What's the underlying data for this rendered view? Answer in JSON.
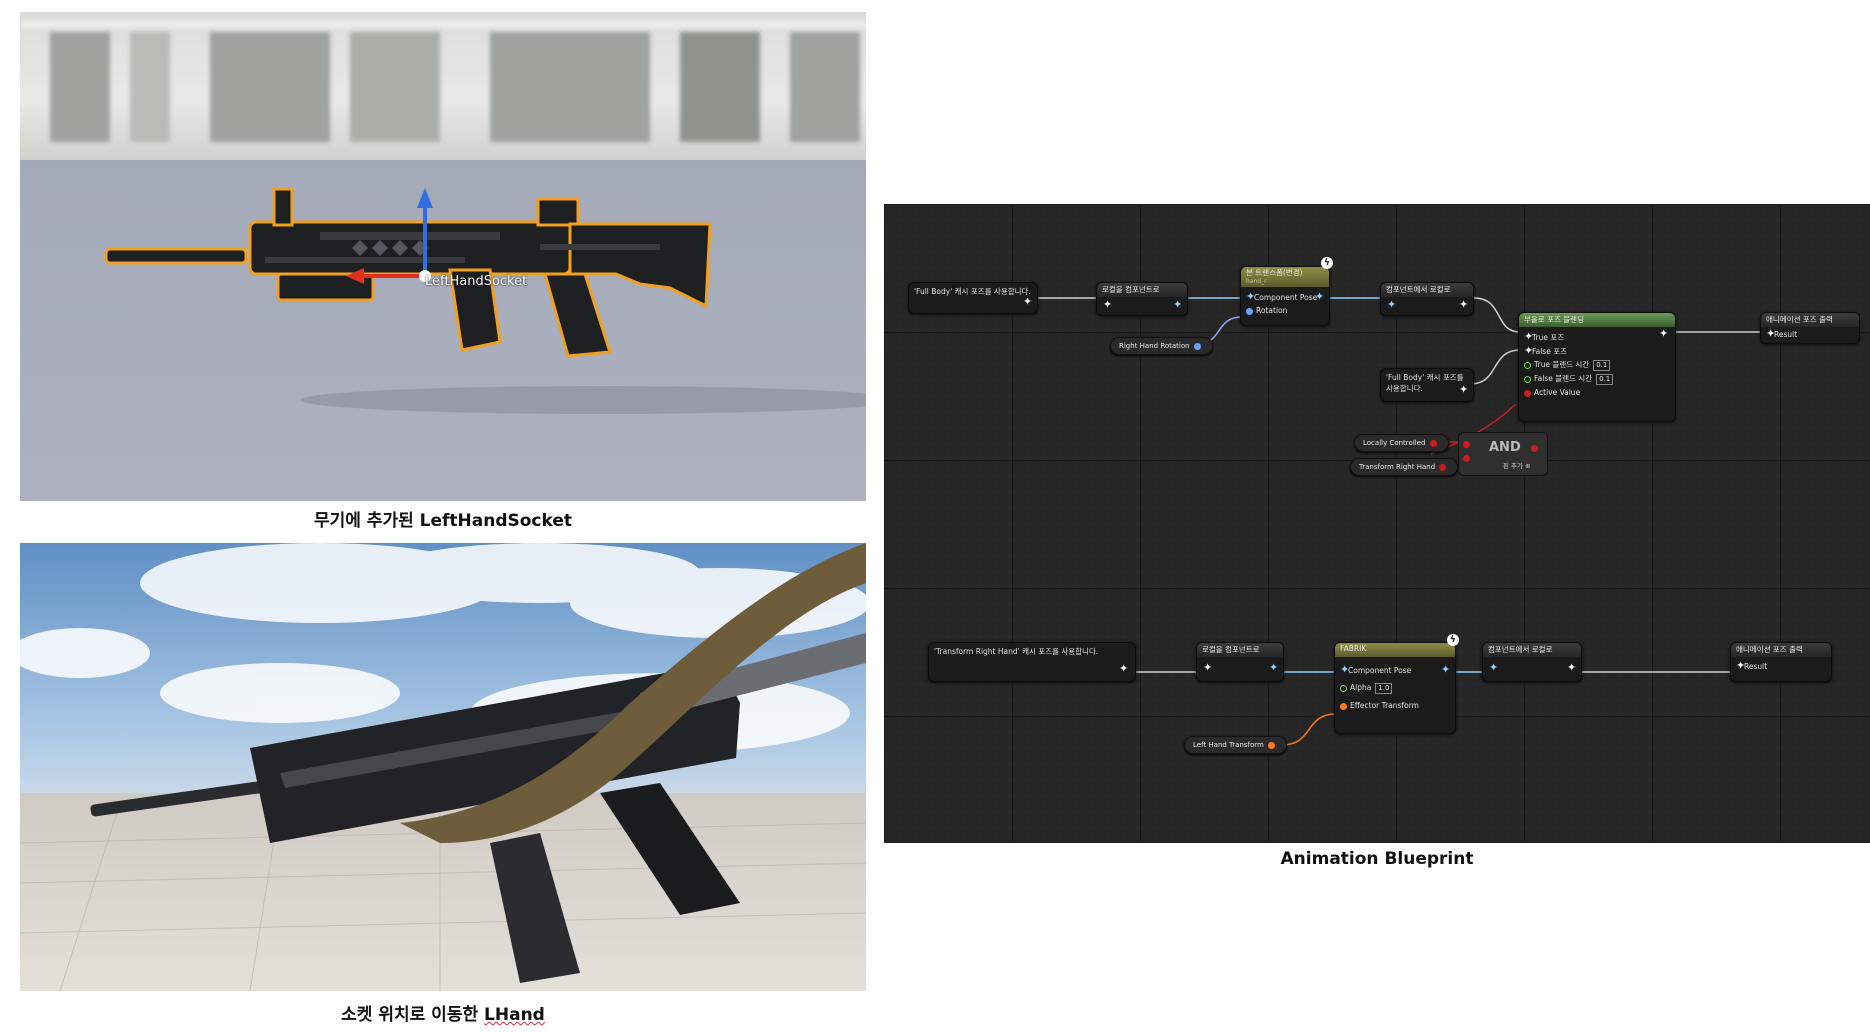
{
  "captions": {
    "top_left": {
      "prefix": "무기에 추가된 ",
      "emph": "LeftHandSocket"
    },
    "bottom_left": {
      "prefix": "소켓 위치로 이동한 ",
      "emph": "LHand"
    },
    "right": "Animation Blueprint"
  },
  "viewport1": {
    "socket_label": "LeftHandSocket"
  },
  "blueprint": {
    "top_graph": {
      "use_cached_fullbody_1": "'Full Body' 캐시 포즈를 사용합니다.",
      "local_to_component": "로컬을 컴포넌트로",
      "bone_transform": {
        "title": "본 트랜스폼(변경)",
        "subtitle": "hand_r",
        "pin_pose": "Component Pose",
        "pin_rotation": "Rotation"
      },
      "component_to_local": "컴포넌트에서 로컬로",
      "blend_by_bool": {
        "title": "부울로 포즈 블렌딩",
        "true_pose": "True 포즈",
        "false_pose": "False 포즈",
        "true_blend": "True 블렌드 시간",
        "true_blend_val": "0.1",
        "false_blend": "False 블렌드 시간",
        "false_blend_val": "0.1",
        "active_value": "Active Value"
      },
      "output_pose": {
        "title": "애니메이션 포즈 출력",
        "result": "Result"
      },
      "right_hand_rotation": "Right Hand Rotation",
      "use_cached_fullbody_2": "'Full Body' 캐시 포즈를 사용합니다.",
      "locally_controlled": "Locally Controlled",
      "transform_right_hand": "Transform Right Hand",
      "and_label": "AND",
      "add_pin": "핀 추가"
    },
    "bottom_graph": {
      "use_cached_trh": "'Transform Right Hand' 캐시 포즈를 사용합니다.",
      "local_to_component": "로컬을 컴포넌트로",
      "fabrik": {
        "title": "FABRIK",
        "pin_pose": "Component Pose",
        "alpha": "Alpha",
        "alpha_val": "1.0",
        "effector": "Effector Transform"
      },
      "component_to_local": "컴포넌트에서 로컬로",
      "output_pose": {
        "title": "애니메이션 포즈 출력",
        "result": "Result"
      },
      "left_hand_transform": "Left Hand Transform"
    }
  },
  "colors": {
    "exec_pose": "#8fd0ff",
    "bool_pin": "#c81e1e",
    "transform_pin": "#ff7a1a",
    "graph_bg": "#262626"
  }
}
